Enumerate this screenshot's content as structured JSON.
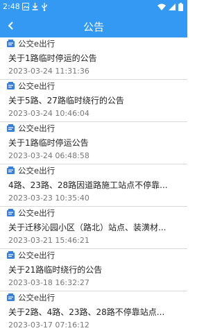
{
  "status_bar": {
    "time": "2:48",
    "left_icons": [
      "image-icon",
      "download-icon",
      "usb-icon"
    ],
    "right_icons": [
      "wifi-icon",
      "signal-icon",
      "battery-icon"
    ]
  },
  "app_bar": {
    "title": "公告",
    "back_icon": "chevron-left-icon",
    "color": "#3399f3"
  },
  "notices": [
    {
      "source": "公交e出行",
      "title": "关于1路临时停运的公告",
      "date": "2023-03-24 11:31:36"
    },
    {
      "source": "公交e出行",
      "title": "关于5路、27路临时绕行的公告",
      "date": "2023-03-24 10:46:04"
    },
    {
      "source": "公交e出行",
      "title": "关于1路临时停运公告",
      "date": "2023-03-24 06:48:58"
    },
    {
      "source": "公交e出行",
      "title": "4路、23路、28路因道路施工站点不停靠...",
      "date": "2023-03-23 10:35:40"
    },
    {
      "source": "公交e出行",
      "title": "关于迁移沁园小区（路北）站点、装潢材...",
      "date": "2023-03-21 15:46:21"
    },
    {
      "source": "公交e出行",
      "title": "关于21路临时绕行的公告",
      "date": "2023-03-18 16:32:27"
    },
    {
      "source": "公交e出行",
      "title": "关于2路、4路、23路、28路不停靠站点...",
      "date": "2023-03-17 07:16:12"
    }
  ]
}
